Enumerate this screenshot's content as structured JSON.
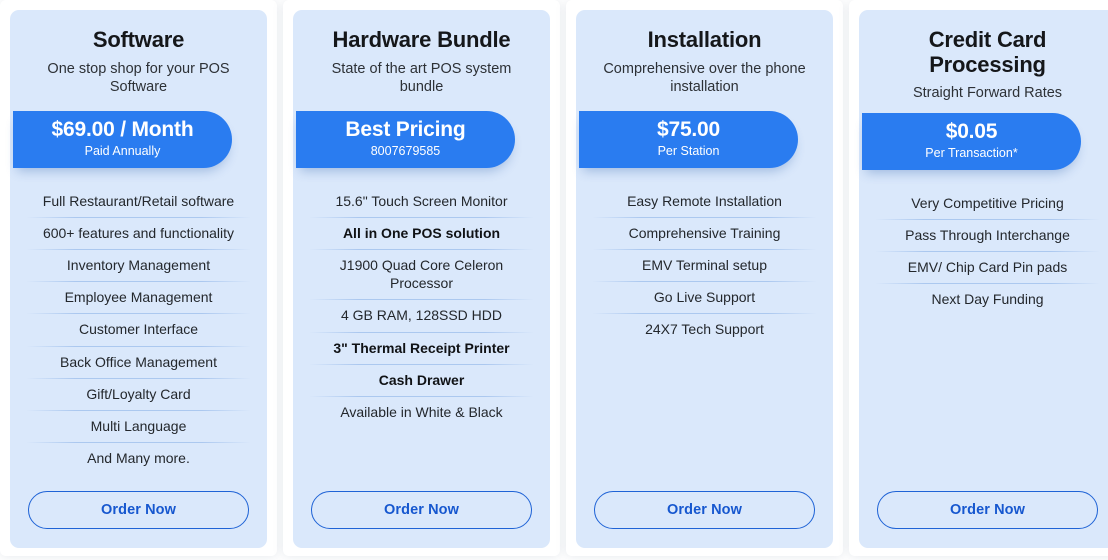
{
  "page": {
    "background_color": "#ffffff",
    "card_background_color": "#dae8fb",
    "accent_color": "#2a7cf0",
    "button_border_color": "#1f63d6",
    "button_text_color": "#1657cf"
  },
  "cards": [
    {
      "title": "Software",
      "subtitle": "One stop shop for your POS Software",
      "badge": {
        "headline": "$69.00 / Month",
        "note": "Paid Annually"
      },
      "features": [
        {
          "text": "Full Restaurant/Retail software",
          "bold": false
        },
        {
          "text": "600+ features and functionality",
          "bold": false
        },
        {
          "text": "Inventory Management",
          "bold": false
        },
        {
          "text": "Employee Management",
          "bold": false
        },
        {
          "text": "Customer Interface",
          "bold": false
        },
        {
          "text": "Back Office Management",
          "bold": false
        },
        {
          "text": "Gift/Loyalty Card",
          "bold": false
        },
        {
          "text": "Multi Language",
          "bold": false
        },
        {
          "text": "And Many more.",
          "bold": false
        }
      ],
      "order_label": "Order Now"
    },
    {
      "title": "Hardware Bundle",
      "subtitle": "State of the art POS system bundle",
      "badge": {
        "headline": "Best Pricing",
        "note": "8007679585"
      },
      "features": [
        {
          "text": "15.6\" Touch Screen Monitor",
          "bold": false
        },
        {
          "text": "All in One POS solution",
          "bold": true
        },
        {
          "text": "J1900 Quad Core Celeron Processor",
          "bold": false
        },
        {
          "text": "4 GB RAM, 128SSD HDD",
          "bold": false
        },
        {
          "text": "3\" Thermal Receipt Printer",
          "bold": true
        },
        {
          "text": "Cash Drawer",
          "bold": true
        },
        {
          "text": "Available in White & Black",
          "bold": false
        }
      ],
      "order_label": "Order Now"
    },
    {
      "title": "Installation",
      "subtitle": "Comprehensive over the phone installation",
      "badge": {
        "headline": "$75.00",
        "note": "Per Station"
      },
      "features": [
        {
          "text": "Easy Remote Installation",
          "bold": false
        },
        {
          "text": "Comprehensive Training",
          "bold": false
        },
        {
          "text": "EMV Terminal setup",
          "bold": false
        },
        {
          "text": "Go Live Support",
          "bold": false
        },
        {
          "text": "24X7 Tech Support",
          "bold": false
        }
      ],
      "order_label": "Order Now"
    },
    {
      "title": "Credit Card Processing",
      "subtitle": "Straight Forward Rates",
      "badge": {
        "headline": "$0.05",
        "note": "Per Transaction*"
      },
      "features": [
        {
          "text": "Very Competitive Pricing",
          "bold": false
        },
        {
          "text": "Pass Through Interchange",
          "bold": false
        },
        {
          "text": "EMV/ Chip Card Pin pads",
          "bold": false
        },
        {
          "text": "Next Day Funding",
          "bold": false
        }
      ],
      "order_label": "Order Now"
    }
  ]
}
